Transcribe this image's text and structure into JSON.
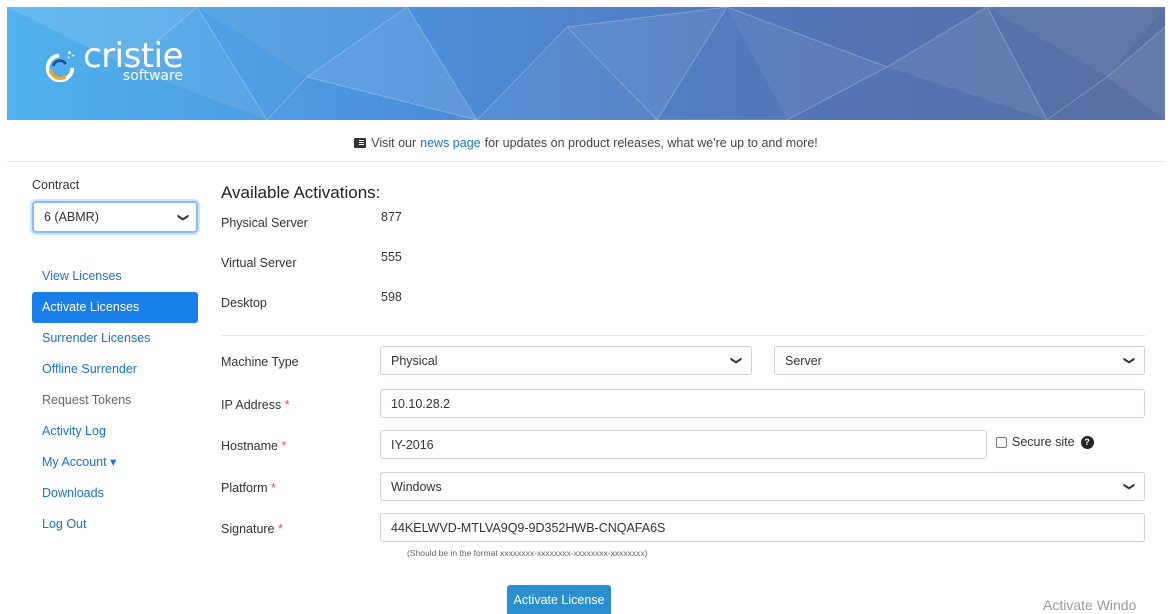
{
  "brand": {
    "name": "cristie",
    "sub": "software"
  },
  "news": {
    "prefix": "Visit our",
    "link": "news page",
    "suffix": "for updates on product releases, what we're up to and more!"
  },
  "sidebar": {
    "contract_label": "Contract",
    "contract_value": "6 (ABMR)",
    "items": [
      {
        "label": "View Licenses"
      },
      {
        "label": "Activate Licenses"
      },
      {
        "label": "Surrender Licenses"
      },
      {
        "label": "Offline Surrender"
      },
      {
        "label": "Request Tokens"
      },
      {
        "label": "Activity Log"
      },
      {
        "label": "My Account ▾"
      },
      {
        "label": "Downloads"
      },
      {
        "label": "Log Out"
      }
    ]
  },
  "activations": {
    "heading": "Available Activations:",
    "rows": [
      {
        "label": "Physical Server",
        "value": "877"
      },
      {
        "label": "Virtual Server",
        "value": "555"
      },
      {
        "label": "Desktop",
        "value": "598"
      }
    ]
  },
  "form": {
    "machine_type_label": "Machine Type",
    "machine_type_value": "Physical",
    "machine_subtype_value": "Server",
    "ip_label": "IP Address",
    "ip_value": "10.10.28.2",
    "hostname_label": "Hostname",
    "hostname_value": "IY-2016",
    "secure_site_label": "Secure site",
    "platform_label": "Platform",
    "platform_value": "Windows",
    "signature_label": "Signature",
    "signature_value": "44KELWVD-MTLVA9Q9-9D352HWB-CNQAFA6S",
    "signature_hint": "(Should be in the format xxxxxxxx-xxxxxxxx-xxxxxxxx-xxxxxxxx)",
    "required_mark": "*",
    "submit_label": "Activate License"
  },
  "watermark": "Activate Windo",
  "colors": {
    "accent": "#1a7ee8",
    "link": "#1a73c9",
    "button": "#2a8fcf",
    "required": "#e05555"
  }
}
